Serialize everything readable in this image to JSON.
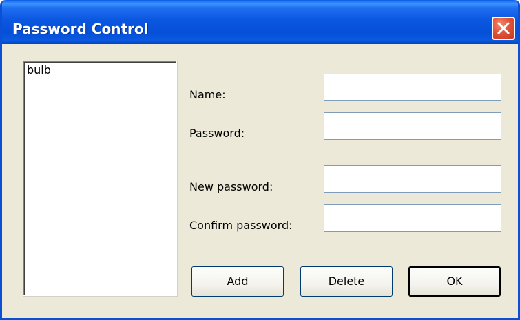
{
  "window": {
    "title": "Password Control",
    "accent_color": "#0a4fd4",
    "close_icon": "close-icon"
  },
  "users_list": {
    "items": [
      "bulb"
    ]
  },
  "form": {
    "name_label": "Name:",
    "name_value": "",
    "password_label": "Password:",
    "password_value": "",
    "new_password_label": "New password:",
    "new_password_value": "",
    "confirm_password_label": "Confirm password:",
    "confirm_password_value": ""
  },
  "buttons": {
    "add_label": "Add",
    "delete_label": "Delete",
    "ok_label": "OK"
  }
}
